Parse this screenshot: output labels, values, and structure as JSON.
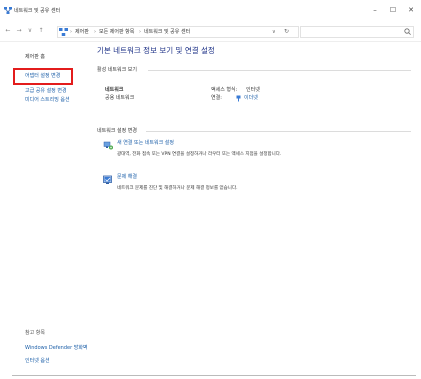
{
  "window": {
    "title": "네트워크 및 공유 센터",
    "controls": {
      "minimize": "–",
      "maximize": "☐",
      "close": "✕"
    }
  },
  "nav": {
    "back": "←",
    "forward": "→",
    "recent": "∨",
    "up": "↑",
    "breadcrumbs": [
      "제어판",
      "모든 제어판 항목",
      "네트워크 및 공유 센터"
    ],
    "separator": "›",
    "dropdown": "∨",
    "refresh": "↻",
    "search_placeholder": ""
  },
  "left_panel": {
    "home": "제어판 홈",
    "links": [
      "어댑터 설정 변경",
      "고급 공유 설정 변경",
      "미디어 스트리밍 옵션"
    ],
    "see_also_heading": "참고 항목",
    "see_also": [
      "Windows Defender 방화벽",
      "인터넷 옵션"
    ]
  },
  "main": {
    "title": "기본 네트워크 정보 보기 및 연결 설정",
    "active_networks": {
      "heading": "활성 네트워크 보기",
      "network_name": "네트워크",
      "network_type": "공용 네트워크",
      "access_type_label": "액세스 형식:",
      "access_type_value": "인터넷",
      "connections_label": "연결:",
      "connections_value": "이더넷"
    },
    "change_settings": {
      "heading": "네트워크 설정 변경",
      "tasks": [
        {
          "icon": "network-setup-icon",
          "title": "새 연결 또는 네트워크 설정",
          "description": "광대역, 전화 접속 또는 VPN 연결을 설정하거나 라우터 또는 액세스 지점을 설정합니다."
        },
        {
          "icon": "troubleshoot-icon",
          "title": "문제 해결",
          "description": "네트워크 문제를 진단 및 해결하거나 문제 해결 정보를 얻습니다."
        }
      ]
    }
  },
  "colors": {
    "title_blue": "#1e3287",
    "link_blue": "#1b5ea8",
    "highlight_red": "#e31c1c"
  }
}
